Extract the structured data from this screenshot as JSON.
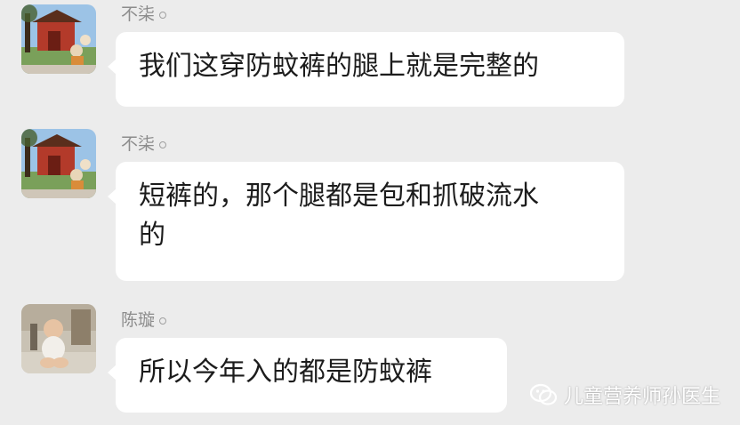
{
  "messages": [
    {
      "sender": "不柒",
      "avatar": "temple-scene-avatar",
      "text_lines": [
        "我们这穿防蚊裤的腿上就是完整的"
      ]
    },
    {
      "sender": "不柒",
      "avatar": "temple-scene-avatar",
      "text_lines": [
        "短裤的，那个腿都是包和抓破流水",
        "的"
      ]
    },
    {
      "sender": "陈璇",
      "avatar": "baby-photo-avatar",
      "text_lines": [
        "所以今年入的都是防蚊裤"
      ]
    }
  ],
  "watermark": {
    "text": "儿童营养师孙医生",
    "icon": "wechat-icon"
  },
  "colors": {
    "background": "#ececec",
    "bubble": "#ffffff",
    "sender_text": "#8c8c8c",
    "message_text": "#1c1c1c"
  }
}
